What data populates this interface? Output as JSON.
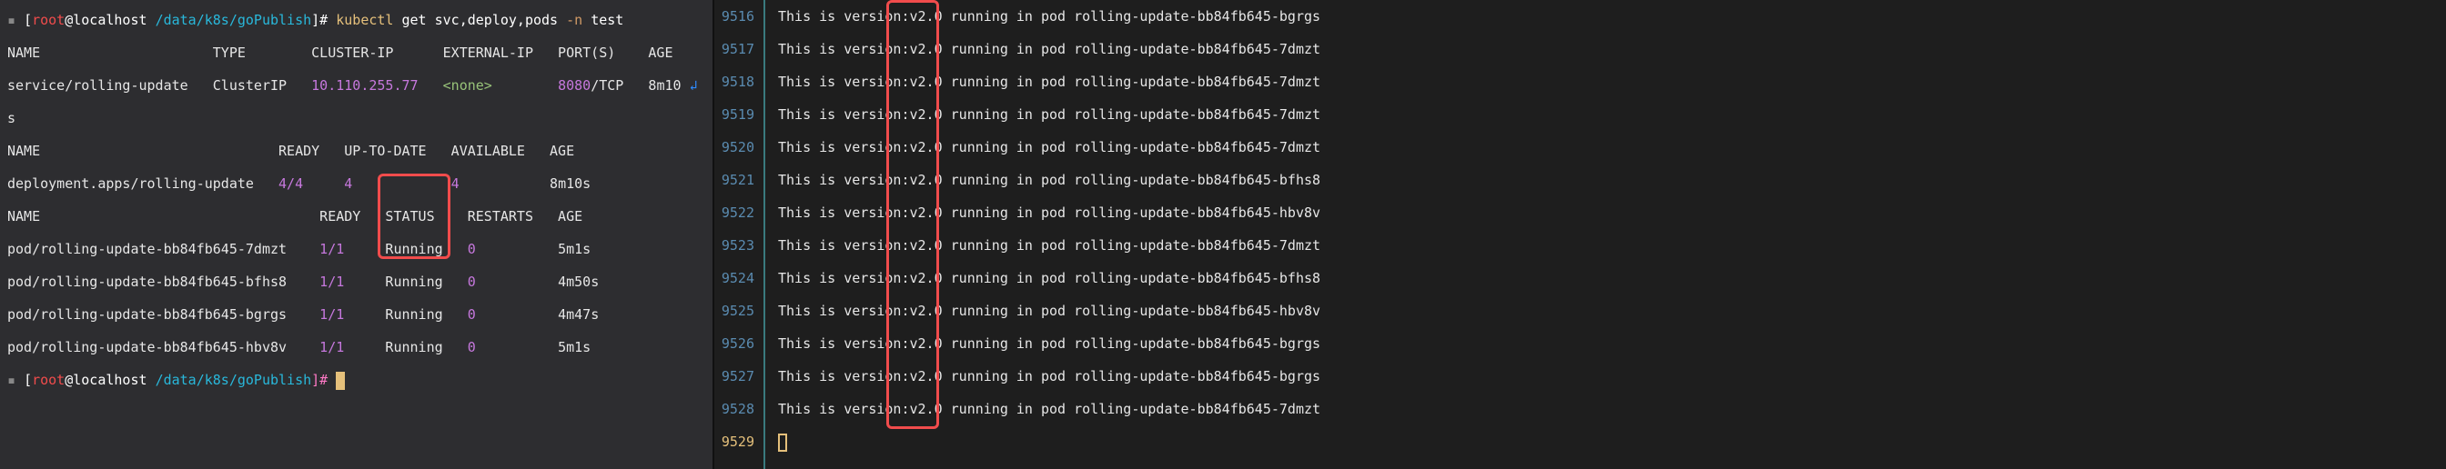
{
  "left": {
    "prompt": {
      "user": "root",
      "at": "@",
      "host": "localhost",
      "path": "/data/k8s/goPublish",
      "hash": "]#"
    },
    "command": {
      "bin": "kubectl",
      "args": "get svc,deploy,pods",
      "flag": "-n",
      "ns": "test"
    },
    "svc_header": "NAME                     TYPE        CLUSTER-IP      EXTERNAL-IP   PORT(S)    AGE",
    "svc_name_line1": "service/rolling-update   ClusterIP   ",
    "svc_ip": "10.110.255.77",
    "svc_ip_pad": "   ",
    "svc_ext": "<none>",
    "svc_ext_pad": "        ",
    "svc_port": "8080",
    "svc_port_suffix": "/TCP   8m10 ",
    "svc_wrap_arrow": "↲",
    "svc_name_line2": "s",
    "blank": "",
    "dep_header": "NAME                             READY   UP-TO-DATE   AVAILABLE   AGE",
    "dep_name": "deployment.apps/rolling-update   ",
    "dep_ready": "4/4",
    "dep_ready_pad": "     ",
    "dep_utd": "4",
    "dep_utd_pad": "            ",
    "dep_avail": "4",
    "dep_avail_pad": "           8m10s",
    "pod_header": "NAME                                  READY   STATUS    RESTARTS   AGE",
    "pods": [
      {
        "name": "pod/rolling-update-bb84fb645-7dmzt    ",
        "ready": "1/1",
        "status": "Running",
        "restarts": "0",
        "age": "5m1s"
      },
      {
        "name": "pod/rolling-update-bb84fb645-bfhs8    ",
        "ready": "1/1",
        "status": "Running",
        "restarts": "0",
        "age": "4m50s"
      },
      {
        "name": "pod/rolling-update-bb84fb645-bgrgs    ",
        "ready": "1/1",
        "status": "Running",
        "restarts": "0",
        "age": "4m47s"
      },
      {
        "name": "pod/rolling-update-bb84fb645-hbv8v    ",
        "ready": "1/1",
        "status": "Running",
        "restarts": "0",
        "age": "5m1s"
      }
    ],
    "pod_ready_pad": "     ",
    "pod_status_pad": "   ",
    "pod_restart_pad": "          ",
    "prompt2": {
      "user": "root",
      "at": "@",
      "host": "localhost",
      "path": "/data/k8s/goPublish",
      "hash": "]#"
    }
  },
  "right": {
    "linenos": [
      "9516",
      "9517",
      "9518",
      "9519",
      "9520",
      "9521",
      "9522",
      "9523",
      "9524",
      "9525",
      "9526",
      "9527",
      "9528",
      "9529"
    ],
    "rows": [
      {
        "text": "This is version:v2.0 running in pod rolling-update-bb84fb645-bgrgs"
      },
      {
        "text": "This is version:v2.0 running in pod rolling-update-bb84fb645-7dmzt"
      },
      {
        "text": "This is version:v2.0 running in pod rolling-update-bb84fb645-7dmzt"
      },
      {
        "text": "This is version:v2.0 running in pod rolling-update-bb84fb645-7dmzt"
      },
      {
        "text": "This is version:v2.0 running in pod rolling-update-bb84fb645-7dmzt"
      },
      {
        "text": "This is version:v2.0 running in pod rolling-update-bb84fb645-bfhs8"
      },
      {
        "text": "This is version:v2.0 running in pod rolling-update-bb84fb645-hbv8v"
      },
      {
        "text": "This is version:v2.0 running in pod rolling-update-bb84fb645-7dmzt"
      },
      {
        "text": "This is version:v2.0 running in pod rolling-update-bb84fb645-bfhs8"
      },
      {
        "text": "This is version:v2.0 running in pod rolling-update-bb84fb645-hbv8v"
      },
      {
        "text": "This is version:v2.0 running in pod rolling-update-bb84fb645-bgrgs"
      },
      {
        "text": "This is version:v2.0 running in pod rolling-update-bb84fb645-bgrgs"
      },
      {
        "text": "This is version:v2.0 running in pod rolling-update-bb84fb645-7dmzt"
      }
    ]
  }
}
